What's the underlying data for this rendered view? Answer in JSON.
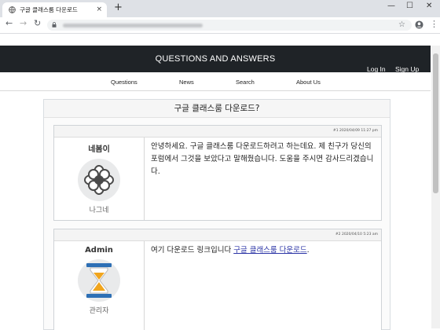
{
  "browser": {
    "tab_title": "구글 클래스룸 다운로드",
    "tab_close": "×",
    "new_tab": "+",
    "minimize": "—",
    "maximize": "☐",
    "close": "✕",
    "back": "←",
    "forward": "→",
    "reload": "↻",
    "bookmark": "☆",
    "menu": "⋮"
  },
  "site": {
    "title": "QUESTIONS AND ANSWERS",
    "login": "Log In",
    "signup": "Sign Up",
    "nav": [
      "Questions",
      "News",
      "Search",
      "About Us"
    ]
  },
  "question": {
    "title": "구글 클래스룸 다운로드?"
  },
  "posts": [
    {
      "meta": "#1 2020/04/09 11:27 pm",
      "author": "네봄이",
      "role": "나그네",
      "icon": "flower-icon",
      "text": "안녕하세요. 구글 클래스룸 다운로드하려고 하는데요. 제 친구가 당신의 포럼에서 그것을 보았다고 말해줬습니다. 도움을 주시면 감사드리겠습니다."
    },
    {
      "meta": "#2 2020/04/10 5:23 am",
      "author": "Admin",
      "role": "관리자",
      "icon": "hourglass-icon",
      "text": "여기 다운로드 링크입니다 ",
      "link": "구글 클래스룸 다운로드",
      "suffix": "."
    }
  ]
}
